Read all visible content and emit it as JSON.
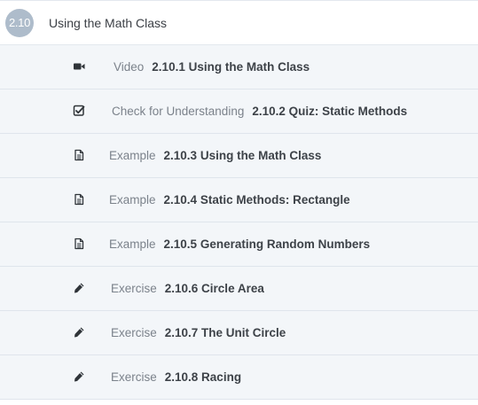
{
  "section": {
    "number": "2.10",
    "title": "Using the Math Class"
  },
  "items": [
    {
      "icon": "video-icon",
      "type": "Video",
      "name": "2.10.1 Using the Math Class"
    },
    {
      "icon": "checkbox-icon",
      "type": "Check for Understanding",
      "name": "2.10.2 Quiz: Static Methods"
    },
    {
      "icon": "document-icon",
      "type": "Example",
      "name": "2.10.3 Using the Math Class"
    },
    {
      "icon": "document-icon",
      "type": "Example",
      "name": "2.10.4 Static Methods: Rectangle"
    },
    {
      "icon": "document-icon",
      "type": "Example",
      "name": "2.10.5 Generating Random Numbers"
    },
    {
      "icon": "pencil-icon",
      "type": "Exercise",
      "name": "2.10.6 Circle Area"
    },
    {
      "icon": "pencil-icon",
      "type": "Exercise",
      "name": "2.10.7 The Unit Circle"
    },
    {
      "icon": "pencil-icon",
      "type": "Exercise",
      "name": "2.10.8 Racing"
    }
  ],
  "colors": {
    "badge": "#aebccb",
    "row_background": "#f3f6f9",
    "type_text": "#7b828b",
    "name_text": "#3d4248"
  }
}
